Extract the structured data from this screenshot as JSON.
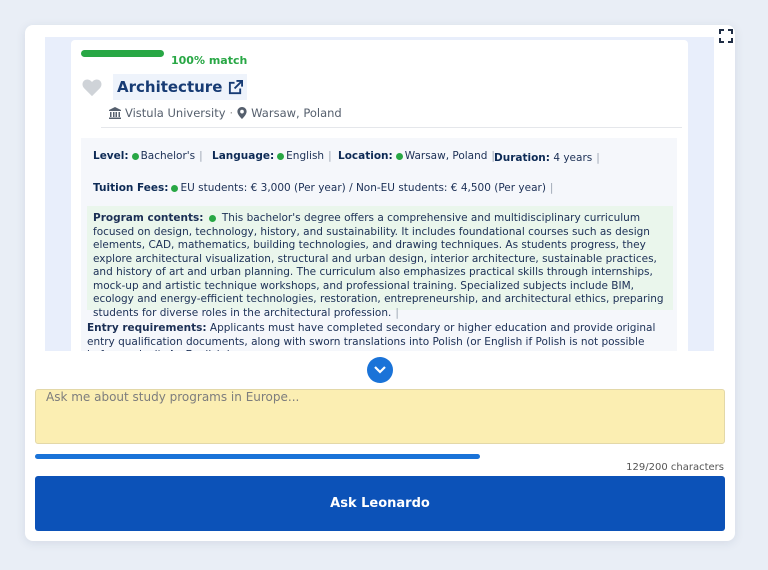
{
  "result": {
    "match_label": "100% match",
    "title": "Architecture",
    "university": "Vistula University",
    "location": "Warsaw, Poland",
    "level": {
      "label": "Level:",
      "value": "Bachelor's"
    },
    "language": {
      "label": "Language:",
      "value": "English"
    },
    "location_field": {
      "label": "Location:",
      "value": "Warsaw, Poland"
    },
    "duration": {
      "label": "Duration:",
      "value": "4 years"
    },
    "tuition": {
      "label": "Tuition Fees:",
      "value": "EU students: € 3,000 (Per year) / Non-EU students: € 4,500 (Per year)"
    },
    "program": {
      "label": "Program contents:",
      "text": "This bachelor's degree offers a comprehensive and multidisciplinary curriculum focused on design, technology, history, and sustainability. It includes foundational courses such as design elements, CAD, mathematics, building technologies, and drawing techniques. As students progress, they explore architectural visualization, structural and urban design, interior architecture, sustainable practices, and history of art and urban planning. The curriculum also emphasizes practical skills through internships, mock-up and artistic technique workshops, and professional training. Specialized subjects include BIM, ecology and energy-efficient technologies, restoration, entrepreneurship, and architectural ethics, preparing students for diverse roles in the architectural profession."
    },
    "entry": {
      "label": "Entry requirements:",
      "text": "Applicants must have completed secondary or higher education and provide original entry qualification documents, along with sworn translations into Polish (or English if Polish is not possible before arrival). An English language"
    }
  },
  "input": {
    "placeholder": "Ask me about study programs in Europe...",
    "char_count": "129/200 characters",
    "progress": 0.645
  },
  "ask_button_label": "Ask Leonardo",
  "colors": {
    "accent": "#0c52b8",
    "match": "#28a745",
    "input_bg": "#fbeeb2"
  }
}
